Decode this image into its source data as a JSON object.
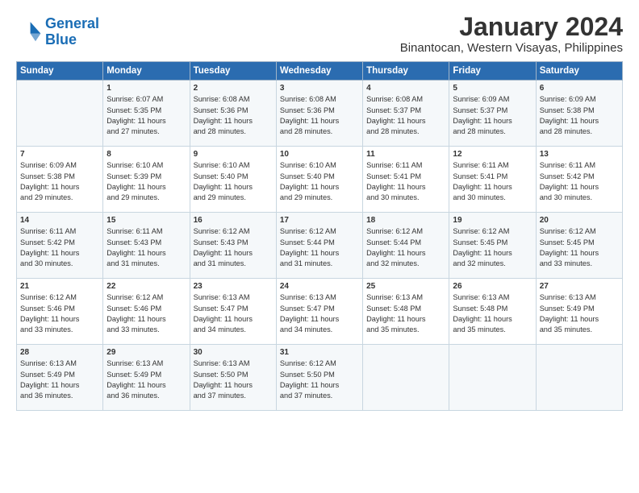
{
  "header": {
    "logo_line1": "General",
    "logo_line2": "Blue",
    "main_title": "January 2024",
    "subtitle": "Binantocan, Western Visayas, Philippines"
  },
  "weekdays": [
    "Sunday",
    "Monday",
    "Tuesday",
    "Wednesday",
    "Thursday",
    "Friday",
    "Saturday"
  ],
  "weeks": [
    [
      {
        "day": "",
        "text": ""
      },
      {
        "day": "1",
        "text": "Sunrise: 6:07 AM\nSunset: 5:35 PM\nDaylight: 11 hours\nand 27 minutes."
      },
      {
        "day": "2",
        "text": "Sunrise: 6:08 AM\nSunset: 5:36 PM\nDaylight: 11 hours\nand 28 minutes."
      },
      {
        "day": "3",
        "text": "Sunrise: 6:08 AM\nSunset: 5:36 PM\nDaylight: 11 hours\nand 28 minutes."
      },
      {
        "day": "4",
        "text": "Sunrise: 6:08 AM\nSunset: 5:37 PM\nDaylight: 11 hours\nand 28 minutes."
      },
      {
        "day": "5",
        "text": "Sunrise: 6:09 AM\nSunset: 5:37 PM\nDaylight: 11 hours\nand 28 minutes."
      },
      {
        "day": "6",
        "text": "Sunrise: 6:09 AM\nSunset: 5:38 PM\nDaylight: 11 hours\nand 28 minutes."
      }
    ],
    [
      {
        "day": "7",
        "text": "Sunrise: 6:09 AM\nSunset: 5:38 PM\nDaylight: 11 hours\nand 29 minutes."
      },
      {
        "day": "8",
        "text": "Sunrise: 6:10 AM\nSunset: 5:39 PM\nDaylight: 11 hours\nand 29 minutes."
      },
      {
        "day": "9",
        "text": "Sunrise: 6:10 AM\nSunset: 5:40 PM\nDaylight: 11 hours\nand 29 minutes."
      },
      {
        "day": "10",
        "text": "Sunrise: 6:10 AM\nSunset: 5:40 PM\nDaylight: 11 hours\nand 29 minutes."
      },
      {
        "day": "11",
        "text": "Sunrise: 6:11 AM\nSunset: 5:41 PM\nDaylight: 11 hours\nand 30 minutes."
      },
      {
        "day": "12",
        "text": "Sunrise: 6:11 AM\nSunset: 5:41 PM\nDaylight: 11 hours\nand 30 minutes."
      },
      {
        "day": "13",
        "text": "Sunrise: 6:11 AM\nSunset: 5:42 PM\nDaylight: 11 hours\nand 30 minutes."
      }
    ],
    [
      {
        "day": "14",
        "text": "Sunrise: 6:11 AM\nSunset: 5:42 PM\nDaylight: 11 hours\nand 30 minutes."
      },
      {
        "day": "15",
        "text": "Sunrise: 6:11 AM\nSunset: 5:43 PM\nDaylight: 11 hours\nand 31 minutes."
      },
      {
        "day": "16",
        "text": "Sunrise: 6:12 AM\nSunset: 5:43 PM\nDaylight: 11 hours\nand 31 minutes."
      },
      {
        "day": "17",
        "text": "Sunrise: 6:12 AM\nSunset: 5:44 PM\nDaylight: 11 hours\nand 31 minutes."
      },
      {
        "day": "18",
        "text": "Sunrise: 6:12 AM\nSunset: 5:44 PM\nDaylight: 11 hours\nand 32 minutes."
      },
      {
        "day": "19",
        "text": "Sunrise: 6:12 AM\nSunset: 5:45 PM\nDaylight: 11 hours\nand 32 minutes."
      },
      {
        "day": "20",
        "text": "Sunrise: 6:12 AM\nSunset: 5:45 PM\nDaylight: 11 hours\nand 33 minutes."
      }
    ],
    [
      {
        "day": "21",
        "text": "Sunrise: 6:12 AM\nSunset: 5:46 PM\nDaylight: 11 hours\nand 33 minutes."
      },
      {
        "day": "22",
        "text": "Sunrise: 6:12 AM\nSunset: 5:46 PM\nDaylight: 11 hours\nand 33 minutes."
      },
      {
        "day": "23",
        "text": "Sunrise: 6:13 AM\nSunset: 5:47 PM\nDaylight: 11 hours\nand 34 minutes."
      },
      {
        "day": "24",
        "text": "Sunrise: 6:13 AM\nSunset: 5:47 PM\nDaylight: 11 hours\nand 34 minutes."
      },
      {
        "day": "25",
        "text": "Sunrise: 6:13 AM\nSunset: 5:48 PM\nDaylight: 11 hours\nand 35 minutes."
      },
      {
        "day": "26",
        "text": "Sunrise: 6:13 AM\nSunset: 5:48 PM\nDaylight: 11 hours\nand 35 minutes."
      },
      {
        "day": "27",
        "text": "Sunrise: 6:13 AM\nSunset: 5:49 PM\nDaylight: 11 hours\nand 35 minutes."
      }
    ],
    [
      {
        "day": "28",
        "text": "Sunrise: 6:13 AM\nSunset: 5:49 PM\nDaylight: 11 hours\nand 36 minutes."
      },
      {
        "day": "29",
        "text": "Sunrise: 6:13 AM\nSunset: 5:49 PM\nDaylight: 11 hours\nand 36 minutes."
      },
      {
        "day": "30",
        "text": "Sunrise: 6:13 AM\nSunset: 5:50 PM\nDaylight: 11 hours\nand 37 minutes."
      },
      {
        "day": "31",
        "text": "Sunrise: 6:12 AM\nSunset: 5:50 PM\nDaylight: 11 hours\nand 37 minutes."
      },
      {
        "day": "",
        "text": ""
      },
      {
        "day": "",
        "text": ""
      },
      {
        "day": "",
        "text": ""
      }
    ]
  ]
}
